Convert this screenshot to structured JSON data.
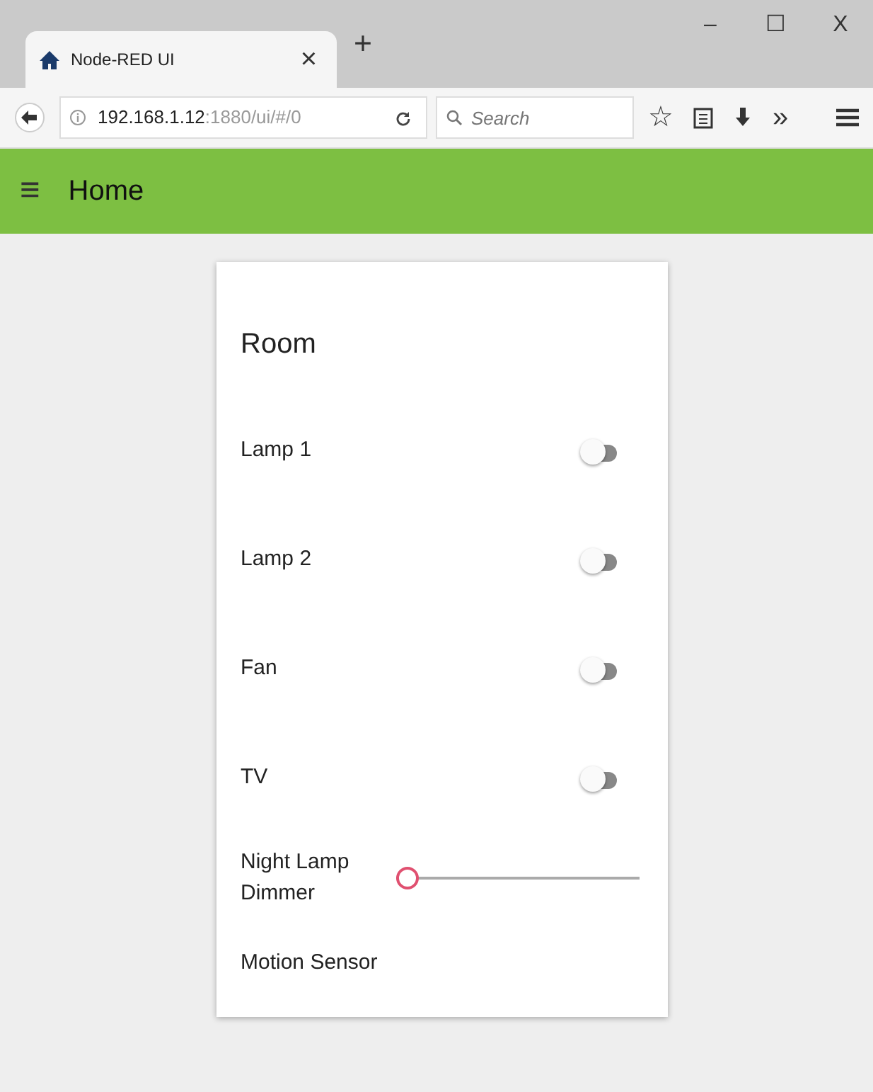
{
  "browser": {
    "tab": {
      "title": "Node-RED UI",
      "close": "×"
    },
    "new_tab": "+",
    "window_controls": [
      "–",
      "☐",
      "X"
    ],
    "url": {
      "host": "192.168.1.12",
      "path": ":1880/ui/#/0"
    },
    "search": {
      "placeholder": "Search"
    },
    "toolbar": [
      "☆",
      "»"
    ]
  },
  "header": {
    "menu": "≡",
    "title": "Home"
  },
  "card": {
    "title": "Room",
    "items": [
      {
        "kind": "switch",
        "label": "Lamp 1",
        "on": false
      },
      {
        "kind": "switch",
        "label": "Lamp 2",
        "on": false
      },
      {
        "kind": "switch",
        "label": "Fan",
        "on": false
      },
      {
        "kind": "switch",
        "label": "TV",
        "on": false
      },
      {
        "kind": "slider",
        "label": "Night Lamp Dimmer",
        "level": 0
      },
      {
        "kind": "text",
        "label": "Motion Sensor"
      }
    ]
  }
}
